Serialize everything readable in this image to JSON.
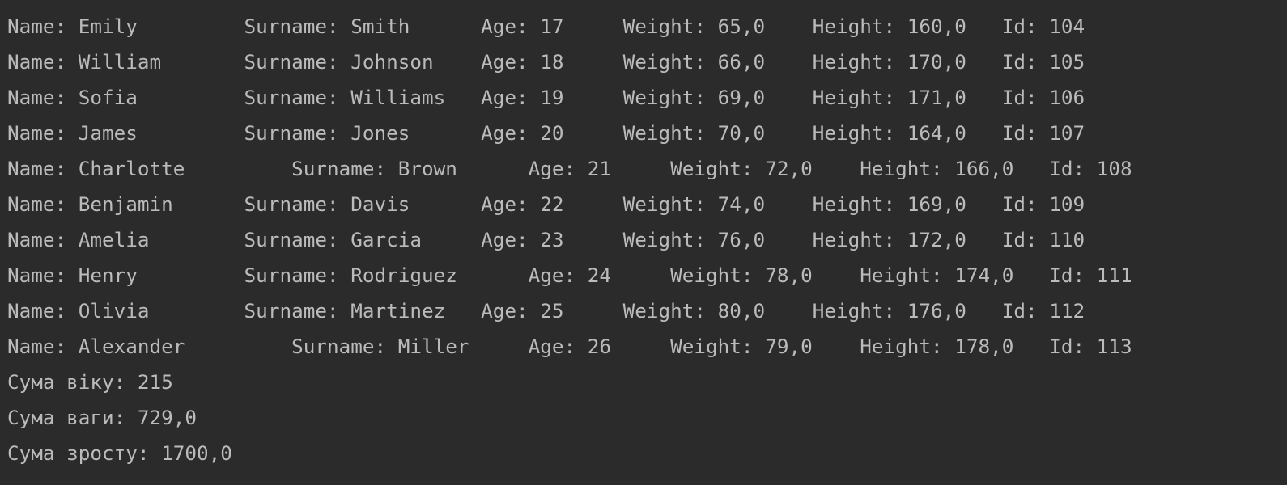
{
  "console": {
    "lines": [
      "Name: Emily         Surname: Smith      Age: 17     Weight: 65,0    Height: 160,0   Id: 104",
      "Name: William       Surname: Johnson    Age: 18     Weight: 66,0    Height: 170,0   Id: 105",
      "Name: Sofia         Surname: Williams   Age: 19     Weight: 69,0    Height: 171,0   Id: 106",
      "Name: James         Surname: Jones      Age: 20     Weight: 70,0    Height: 164,0   Id: 107",
      "Name: Charlotte         Surname: Brown      Age: 21     Weight: 72,0    Height: 166,0   Id: 108",
      "Name: Benjamin      Surname: Davis      Age: 22     Weight: 74,0    Height: 169,0   Id: 109",
      "Name: Amelia        Surname: Garcia     Age: 23     Weight: 76,0    Height: 172,0   Id: 110",
      "Name: Henry         Surname: Rodriguez      Age: 24     Weight: 78,0    Height: 174,0   Id: 111",
      "Name: Olivia        Surname: Martinez   Age: 25     Weight: 80,0    Height: 176,0   Id: 112",
      "Name: Alexander         Surname: Miller     Age: 26     Weight: 79,0    Height: 178,0   Id: 113",
      "Сума віку: 215",
      "Сума ваги: 729,0",
      "Сума зросту: 1700,0"
    ]
  }
}
